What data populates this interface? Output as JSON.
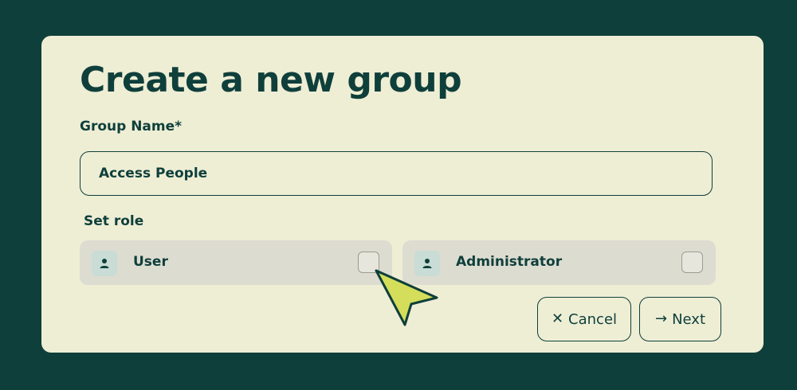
{
  "dialog": {
    "title": "Create a new group",
    "group_name_label": "Group Name*",
    "group_name_value": "Access People",
    "set_role_label": "Set role"
  },
  "roles": [
    {
      "label": "User",
      "icon": "user-icon",
      "checked": false
    },
    {
      "label": "Administrator",
      "icon": "user-icon",
      "checked": false
    }
  ],
  "actions": {
    "cancel_label": "Cancel",
    "cancel_icon": "close-icon",
    "next_label": "Next",
    "next_icon": "arrow-right-icon"
  },
  "colors": {
    "background": "#0f3f3b",
    "card": "#eeeed5",
    "text": "#0f3f3b",
    "role_option": "#dddcd1",
    "cursor": "#d4de5a"
  }
}
